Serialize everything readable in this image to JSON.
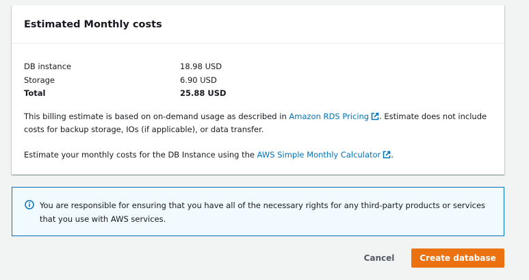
{
  "cost_panel": {
    "title": "Estimated Monthly costs",
    "rows": [
      {
        "label": "DB instance",
        "value": "18.98 USD"
      },
      {
        "label": "Storage",
        "value": "6.90 USD"
      }
    ],
    "total": {
      "label": "Total",
      "value": "25.88 USD"
    },
    "estimate_note": {
      "prefix": "This billing estimate is based on on-demand usage as described in ",
      "link_text": "Amazon RDS Pricing",
      "suffix": ". Estimate does not include costs for backup storage, IOs (if applicable), or data transfer."
    },
    "calculator_note": {
      "prefix": "Estimate your monthly costs for the DB Instance using the ",
      "link_text": "AWS Simple Monthly Calculator",
      "suffix": "."
    },
    "link_icon": "external-link-icon"
  },
  "info_alert": {
    "icon": "info-icon",
    "text": "You are responsible for ensuring that you have all of the necessary rights for any third-party products or services that you use with AWS services."
  },
  "actions": {
    "cancel_label": "Cancel",
    "create_label": "Create database"
  },
  "colors": {
    "accent_orange": "#ec7211",
    "link_blue": "#0073bb",
    "info_background": "#f1faff",
    "page_background": "#f2f3f3"
  }
}
